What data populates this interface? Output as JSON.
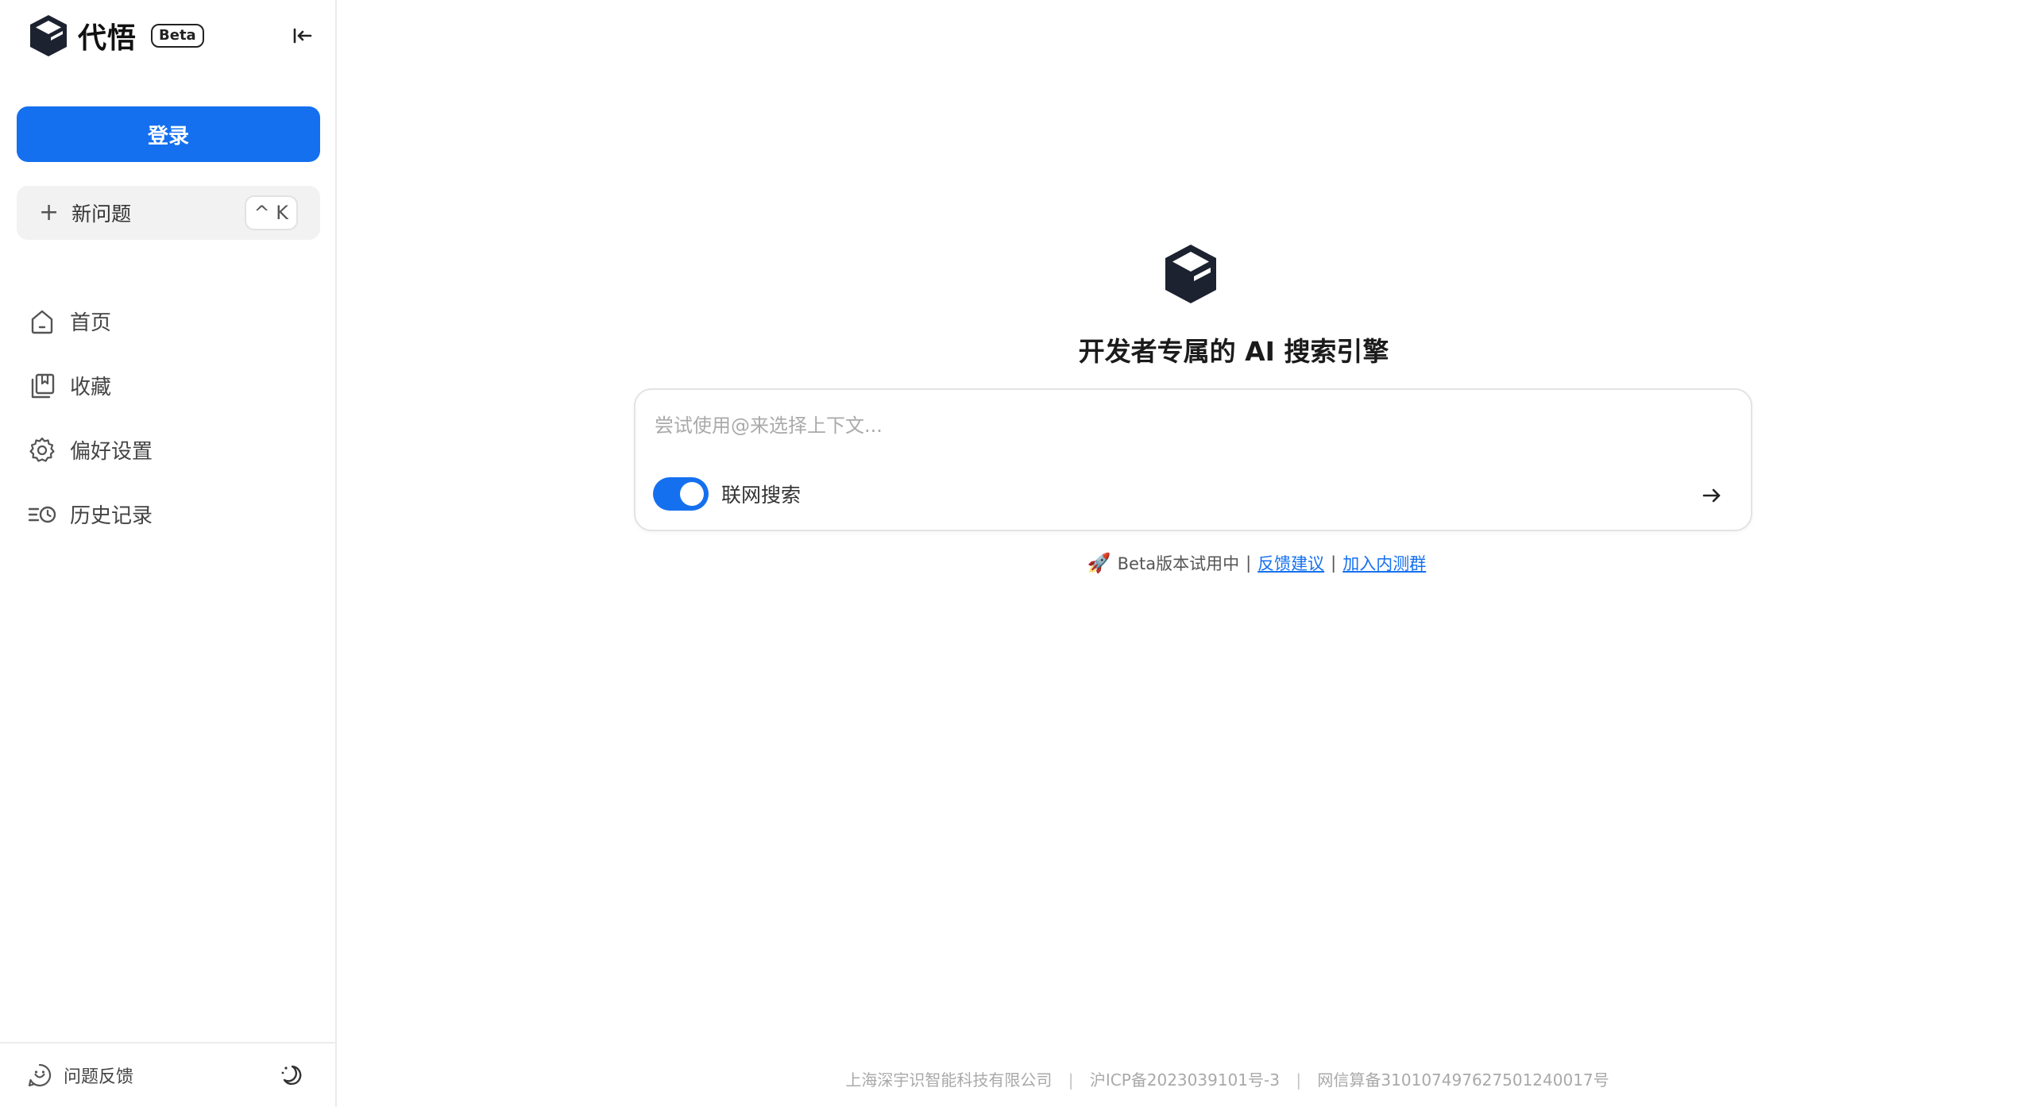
{
  "brand": {
    "name": "代悟",
    "badge": "Beta"
  },
  "sidebar": {
    "login_label": "登录",
    "new_question": {
      "label": "新问题",
      "shortcut": "^ K"
    },
    "items": [
      {
        "label": "首页",
        "icon": "home-icon"
      },
      {
        "label": "收藏",
        "icon": "collection-icon"
      },
      {
        "label": "偏好设置",
        "icon": "gear-icon"
      },
      {
        "label": "历史记录",
        "icon": "history-icon"
      }
    ],
    "feedback_label": "问题反馈"
  },
  "main": {
    "title": "开发者专属的 AI 搜索引擎",
    "search": {
      "placeholder": "尝试使用@来选择上下文...",
      "value": "",
      "web_search_label": "联网搜索",
      "web_search_enabled": true
    },
    "beta_note": {
      "text": "Beta版本试用中",
      "sep": "|",
      "feedback_link": "反馈建议",
      "join_link": "加入内测群"
    },
    "footer": {
      "company": "上海深宇识智能科技有限公司",
      "icp": "沪ICP备2023039101号-3",
      "algo": "网信算备310107497627501240017号",
      "sep": "|"
    }
  },
  "colors": {
    "accent": "#1570ef",
    "text": "#1f1f1f",
    "muted": "#a9a9a9"
  }
}
